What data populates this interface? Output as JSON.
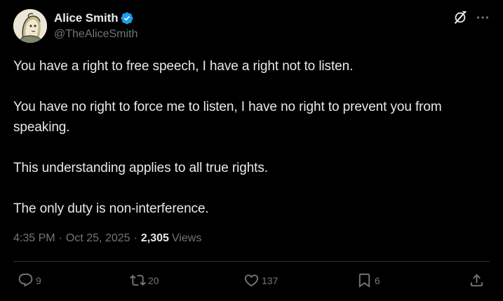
{
  "author": {
    "display_name": "Alice Smith",
    "handle": "@TheAliceSmith",
    "verified": true,
    "verified_color": "#1d9bf0"
  },
  "tweet": {
    "paragraphs": [
      "You have a right to free speech, I have a right not to listen.",
      "You have no right to force me to listen, I have no right to prevent you from speaking.",
      "This understanding applies to all true rights.",
      "The only duty is non-interference."
    ],
    "time": "4:35 PM",
    "date": "Oct 25, 2025",
    "separator": "·",
    "views_count": "2,305",
    "views_label": "Views"
  },
  "actions": {
    "replies": "9",
    "reposts": "20",
    "likes": "137",
    "bookmarks": "6"
  },
  "icons": {
    "top_right": [
      "grok-icon",
      "more-icon"
    ],
    "bottom": [
      "reply-icon",
      "repost-icon",
      "like-icon",
      "bookmark-icon",
      "share-icon"
    ]
  },
  "colors": {
    "background": "#000000",
    "text_primary": "#e7e9ea",
    "text_secondary": "#71767b",
    "divider": "#2f3336"
  }
}
